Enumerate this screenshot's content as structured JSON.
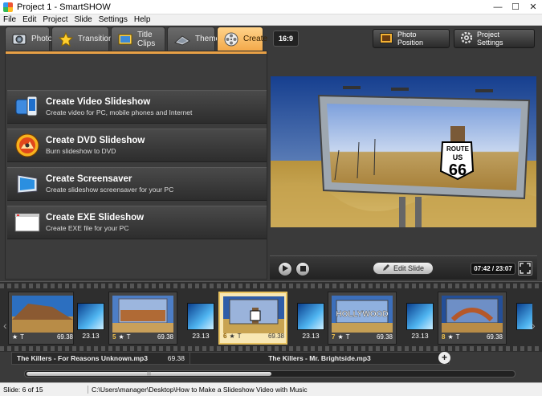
{
  "window": {
    "title": "Project 1 - SmartSHOW",
    "controls": [
      "—",
      "☐",
      "✕"
    ]
  },
  "menu": [
    "File",
    "Edit",
    "Project",
    "Slide",
    "Settings",
    "Help"
  ],
  "tabs": [
    {
      "label": "Photos",
      "icon": "photos-icon"
    },
    {
      "label": "Transitions",
      "icon": "star-icon"
    },
    {
      "label": "Title Clips",
      "icon": "title-clips-icon"
    },
    {
      "label": "Themes",
      "icon": "themes-icon"
    },
    {
      "label": "Create",
      "icon": "film-reel-icon",
      "active": true
    }
  ],
  "create_options": [
    {
      "title": "Create Video Slideshow",
      "subtitle": "Create video for PC, mobile phones and Internet",
      "icon": "video-device-icon"
    },
    {
      "title": "Create DVD Slideshow",
      "subtitle": "Burn slideshow to DVD",
      "icon": "dvd-disc-icon"
    },
    {
      "title": "Create Screensaver",
      "subtitle": "Create slideshow screensaver for your PC",
      "icon": "monitor-icon"
    },
    {
      "title": "Create EXE Slideshow",
      "subtitle": "Create EXE file for your PC",
      "icon": "exe-window-icon"
    }
  ],
  "toolbar": {
    "ratio": "16:9",
    "photo_position": "Photo Position",
    "project_settings": "Project Settings"
  },
  "preview": {
    "sign_route": "ROUTE",
    "sign_us": "US",
    "sign_number": "66"
  },
  "player": {
    "edit_slide": "Edit Slide",
    "time": "07:42 / 23:07"
  },
  "slides": [
    {
      "num": "",
      "duration": "69.38",
      "theme": "desert"
    },
    {
      "num": "5",
      "duration": "69.38",
      "theme": "canyon"
    },
    {
      "num": "6",
      "duration": "69.38",
      "theme": "route66",
      "selected": true
    },
    {
      "num": "7",
      "duration": "69.38",
      "theme": "hollywood",
      "caption": "HOLLYWOOD"
    },
    {
      "num": "8",
      "duration": "69.38",
      "theme": "arch"
    }
  ],
  "transitions": [
    "23.13",
    "23.13",
    "23.13",
    "23.13"
  ],
  "music": [
    {
      "title": "The Killers - For Reasons Unknown.mp3",
      "duration": "69.38"
    },
    {
      "title": "The Killers - Mr. Brightside.mp3",
      "duration": ""
    }
  ],
  "scroll_position": 0.5,
  "status": {
    "slide": "Slide: 6 of 15",
    "path": "C:\\Users\\manager\\Desktop\\How to Make a Slideshow Video with Music"
  }
}
